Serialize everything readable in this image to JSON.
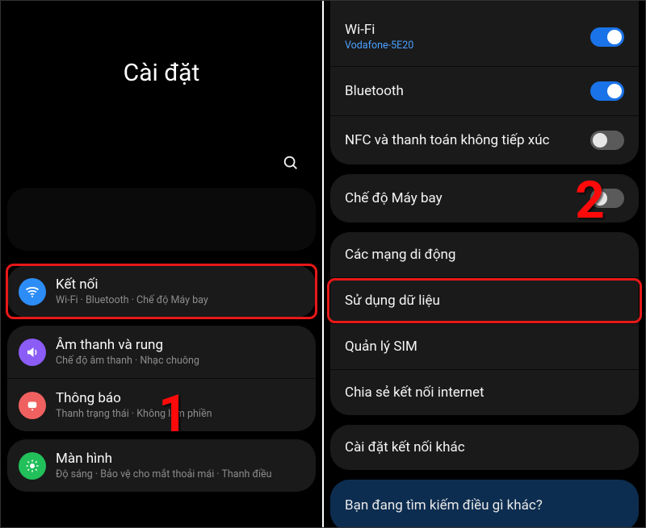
{
  "left": {
    "title": "Cài đặt",
    "search_icon": "search-icon",
    "categories": [
      {
        "key": "connections",
        "title": "Kết nối",
        "sub": "Wi-Fi · Bluetooth · Chế độ Máy bay",
        "icon": "wifi-icon",
        "highlighted": true
      },
      {
        "key": "sound",
        "title": "Âm thanh và rung",
        "sub": "Chế độ âm thanh · Nhạc chuông",
        "icon": "sound-icon",
        "highlighted": false
      },
      {
        "key": "notif",
        "title": "Thông báo",
        "sub": "Thanh trạng thái · Không làm phiền",
        "icon": "notification-icon",
        "highlighted": false
      },
      {
        "key": "display",
        "title": "Màn hình",
        "sub": "Độ sáng · Bảo vệ cho mắt thoải mái · Thanh điều",
        "icon": "display-icon",
        "highlighted": false
      }
    ],
    "step_label": "1"
  },
  "right": {
    "groups": [
      [
        {
          "key": "wifi",
          "title": "Wi-Fi",
          "sub": "Vodafone-5E20",
          "toggle": "on"
        },
        {
          "key": "bluetooth",
          "title": "Bluetooth",
          "toggle": "on"
        },
        {
          "key": "nfc",
          "title": "NFC và thanh toán không tiếp xúc",
          "toggle": "off"
        }
      ],
      [
        {
          "key": "airplane",
          "title": "Chế độ Máy bay",
          "toggle": "off"
        }
      ],
      [
        {
          "key": "mobile",
          "title": "Các mạng di động"
        },
        {
          "key": "datausage",
          "title": "Sử dụng dữ liệu",
          "highlighted": true
        },
        {
          "key": "sim",
          "title": "Quản lý SIM"
        },
        {
          "key": "tether",
          "title": "Chia sẻ kết nối internet"
        }
      ],
      [
        {
          "key": "more",
          "title": "Cài đặt kết nối khác"
        }
      ]
    ],
    "suggestion": "Bạn đang tìm kiếm điều gì khác?",
    "step_label": "2"
  },
  "colors": {
    "accent": "#1a73e8",
    "highlight": "#e81818",
    "link": "#4aa0ff"
  }
}
